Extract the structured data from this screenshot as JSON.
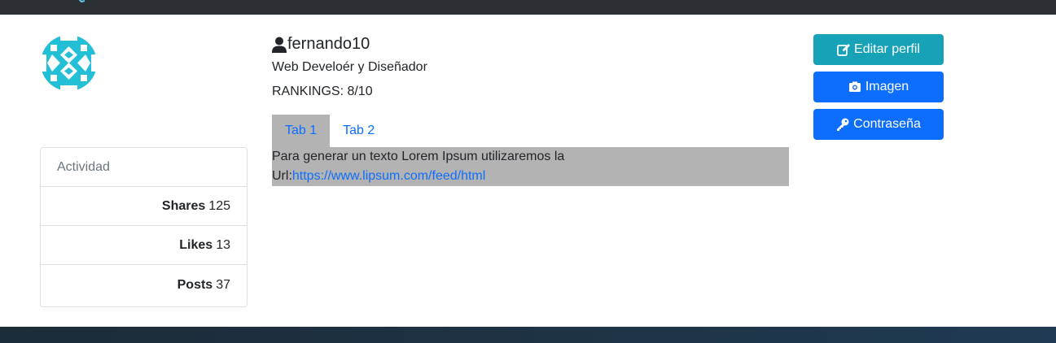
{
  "profile": {
    "username": "fernando10",
    "role": "Web Develoér y Diseñador",
    "ranking": "RANKINGS: 8/10"
  },
  "stats": {
    "header": "Actividad",
    "items": [
      {
        "label": "Shares",
        "value": "125"
      },
      {
        "label": "Likes",
        "value": "13"
      },
      {
        "label": "Posts",
        "value": "37"
      }
    ]
  },
  "tabs": [
    {
      "label": "Tab 1",
      "active": true
    },
    {
      "label": "Tab 2",
      "active": false
    }
  ],
  "panel": {
    "text_line1": "Para generar un texto Lorem Ipsum utilizaremos la",
    "url_prefix": "Url:",
    "url": "https://www.lipsum.com/feed/html"
  },
  "actions": {
    "edit_label": "Editar perfil",
    "image_label": "Imagen",
    "password_label": "Contraseña"
  },
  "colors": {
    "topbar": "#2b3035",
    "accent_info": "#17a2b8",
    "accent_primary": "#0d6efd",
    "tab_active_bg": "#b3b3b3",
    "avatar_color": "#22bfd6"
  },
  "icons": {
    "avatar": "identicon-avatar",
    "username": "user-icon",
    "edit": "edit-icon",
    "image": "camera-icon",
    "password": "key-icon"
  }
}
